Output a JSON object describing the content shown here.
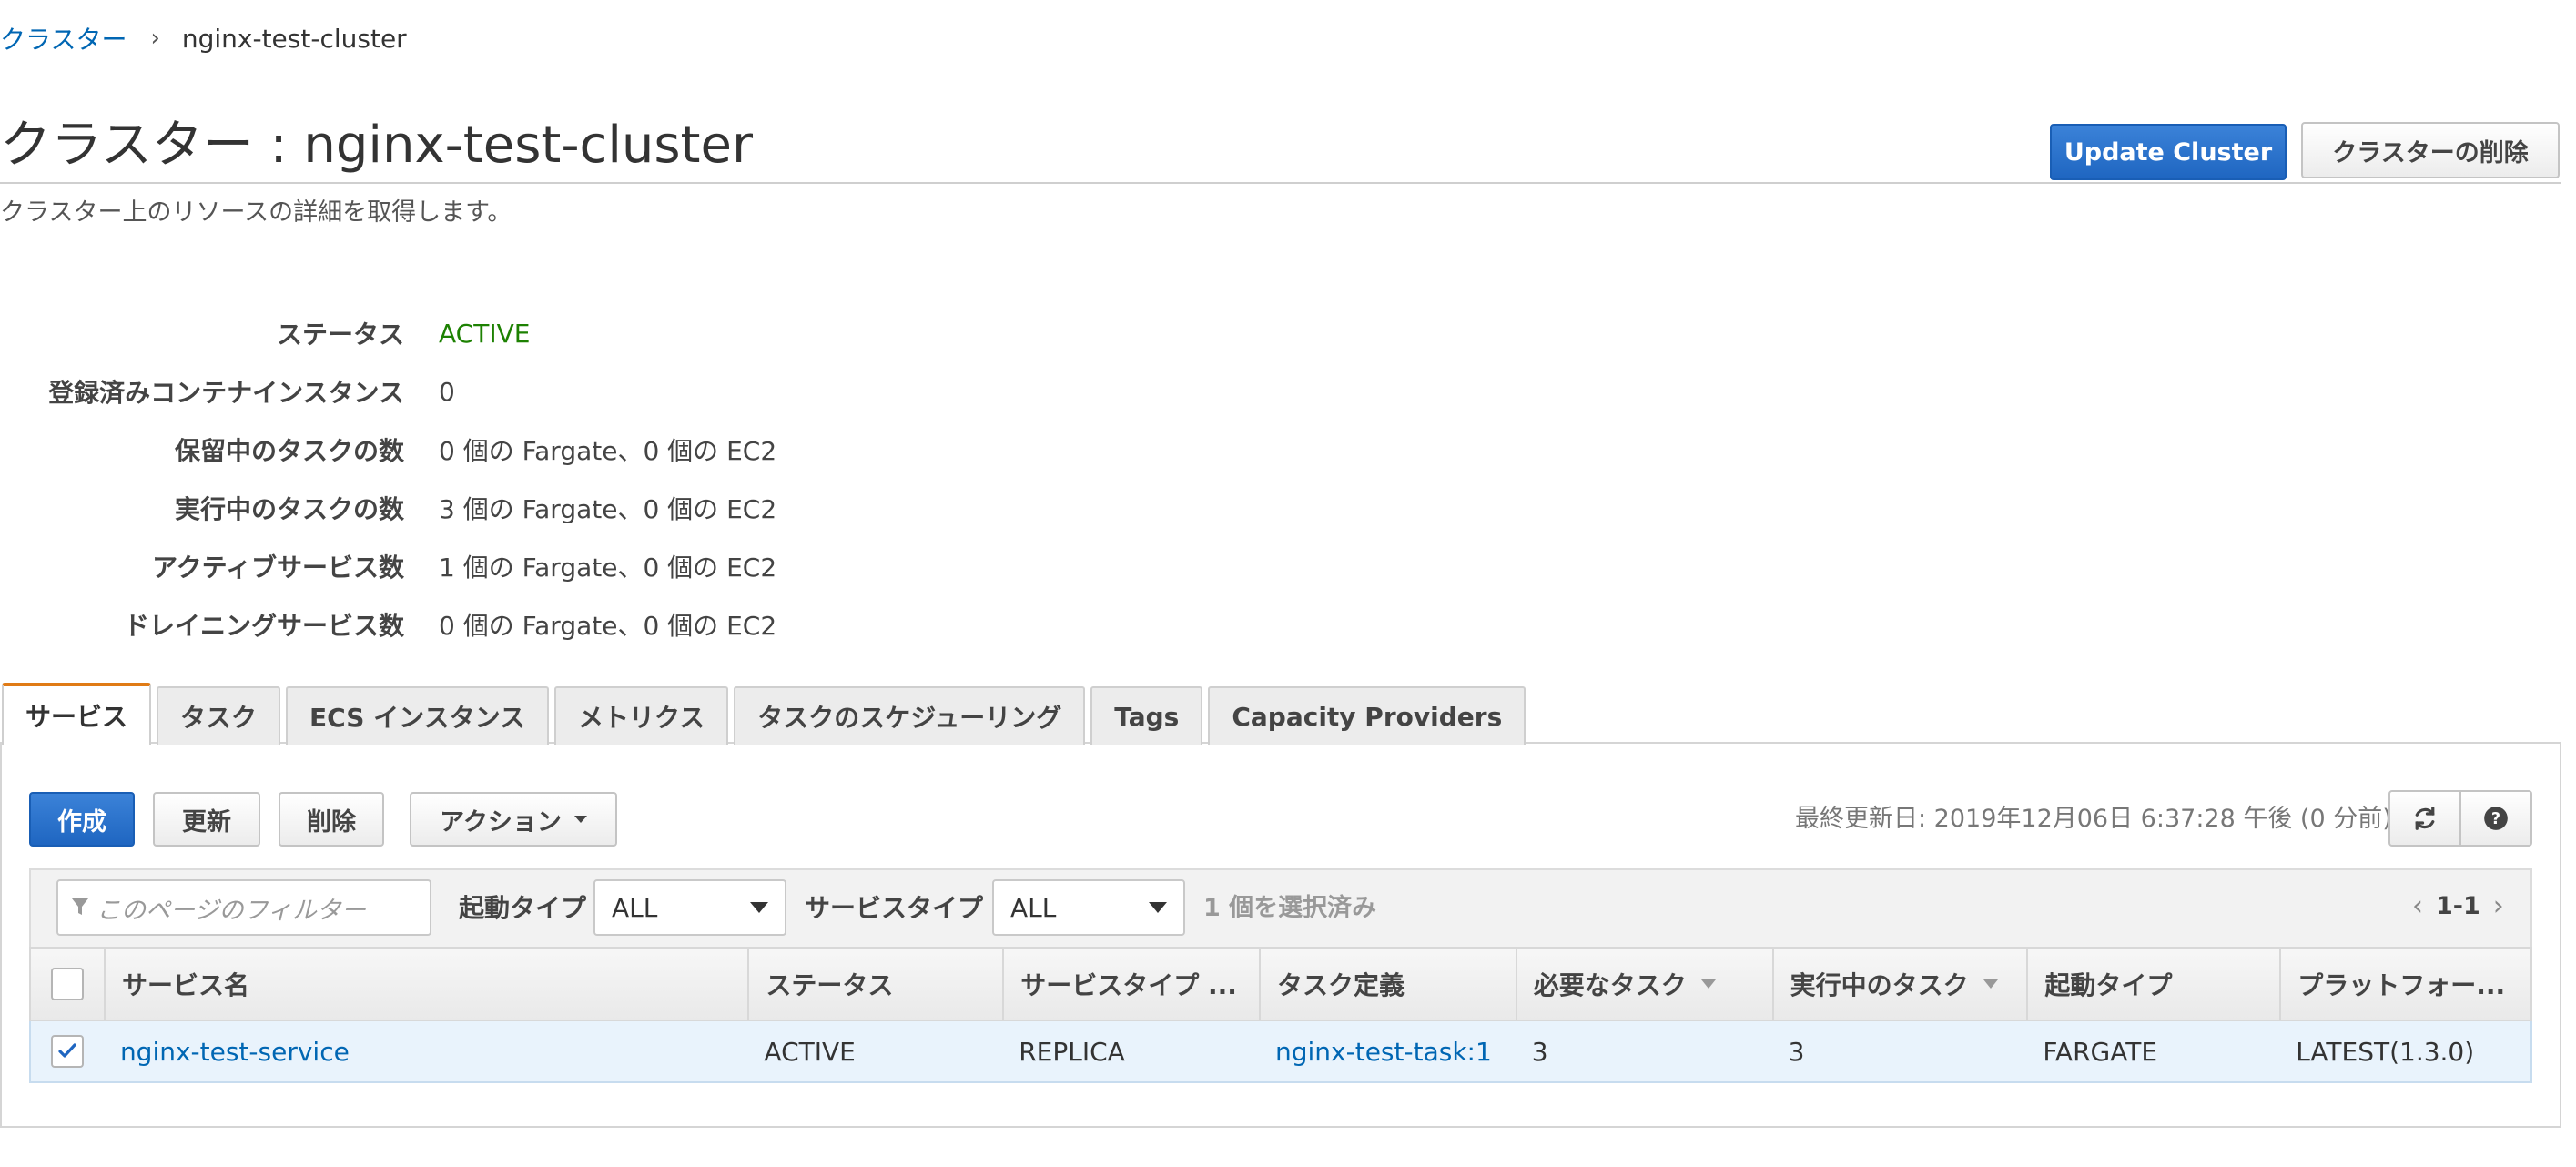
{
  "breadcrumb": {
    "parent": "クラスター",
    "separator": "›",
    "current": "nginx-test-cluster"
  },
  "header": {
    "title": "クラスター : nginx-test-cluster",
    "subtitle": "クラスター上のリソースの詳細を取得します。",
    "update_button": "Update Cluster",
    "delete_button": "クラスターの削除"
  },
  "details": [
    {
      "label": "ステータス",
      "value": "ACTIVE"
    },
    {
      "label": "登録済みコンテナインスタンス",
      "value": "0"
    },
    {
      "label": "保留中のタスクの数",
      "value": "0 個の Fargate、0 個の EC2"
    },
    {
      "label": "実行中のタスクの数",
      "value": "3 個の Fargate、0 個の EC2"
    },
    {
      "label": "アクティブサービス数",
      "value": "1 個の Fargate、0 個の EC2"
    },
    {
      "label": "ドレイニングサービス数",
      "value": "0 個の Fargate、0 個の EC2"
    }
  ],
  "tabs": [
    {
      "label": "サービス",
      "active": true
    },
    {
      "label": "タスク"
    },
    {
      "label": "ECS インスタンス"
    },
    {
      "label": "メトリクス"
    },
    {
      "label": "タスクのスケジューリング"
    },
    {
      "label": "Tags"
    },
    {
      "label": "Capacity Providers"
    }
  ],
  "toolbar": {
    "create": "作成",
    "refresh": "更新",
    "delete": "削除",
    "actions": "アクション",
    "last_updated": "最終更新日: 2019年12月06日 6:37:28 午後 (0 分前)"
  },
  "filter": {
    "placeholder": "このページのフィルター",
    "launch_type_label": "起動タイプ",
    "launch_type_value": "ALL",
    "service_type_label": "サービスタイプ",
    "service_type_value": "ALL",
    "selected_count": "1 個を選択済み",
    "pagination": "1-1"
  },
  "table": {
    "columns": [
      "サービス名",
      "ステータス",
      "サービスタイプ ...",
      "タスク定義",
      "必要なタスク",
      "実行中のタスク",
      "起動タイプ",
      "プラットフォー..."
    ],
    "rows": [
      {
        "selected": true,
        "service_name": "nginx-test-service",
        "status": "ACTIVE",
        "service_type": "REPLICA",
        "task_definition": "nginx-test-task:1",
        "desired_tasks": "3",
        "running_tasks": "3",
        "launch_type": "FARGATE",
        "platform": "LATEST(1.3.0)"
      }
    ]
  },
  "colors": {
    "primary": "#1f66c1",
    "link": "#0066b3",
    "status_active": "#1d8102",
    "tab_accent": "#e07b16",
    "selected_row": "#e9f3fc"
  },
  "icons": {
    "refresh": "refresh-icon",
    "help": "help-icon",
    "filter": "filter-icon",
    "checkmark": "checkmark-icon"
  }
}
